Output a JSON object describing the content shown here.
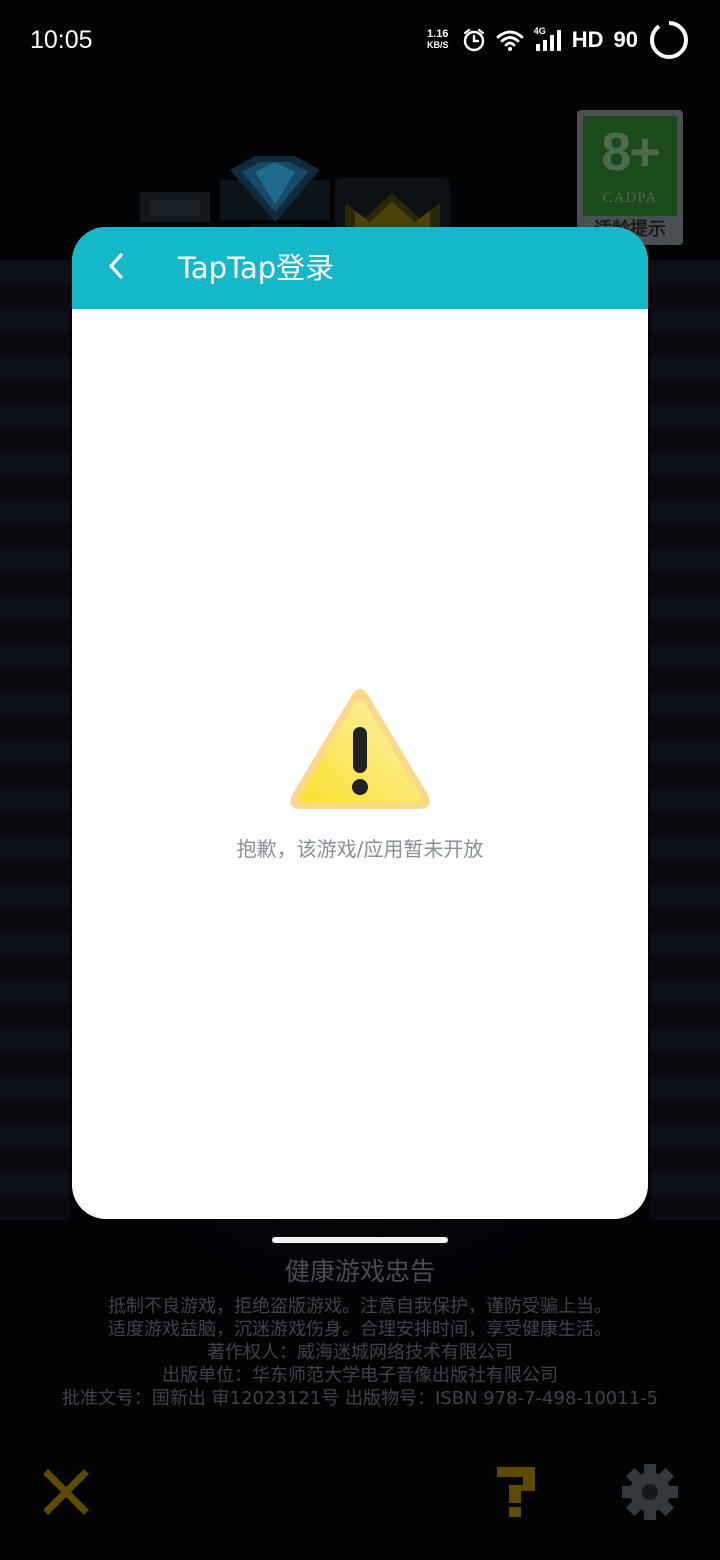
{
  "status_bar": {
    "time": "10:05",
    "net_speed_value": "1.16",
    "net_speed_unit": "KB/S",
    "network_type": "4G",
    "hd_label": "HD",
    "battery": "90",
    "icons": [
      "alarm-icon",
      "wifi-icon",
      "signal-icon",
      "battery-ring-icon"
    ]
  },
  "age_rating": {
    "rating": "8+",
    "org": "CADPA",
    "caption": "适龄提示"
  },
  "modal": {
    "title": "TapTap登录",
    "back_icon": "chevron-left-icon",
    "warning_icon": "warning-triangle-icon",
    "message": "抱歉，该游戏/应用暂未开放",
    "header_color": "#15b8c8"
  },
  "advisory": {
    "title": "健康游戏忠告",
    "lines": [
      "抵制不良游戏，拒绝盗版游戏。注意自我保护，谨防受骗上当。",
      "适度游戏益脑，沉迷游戏伤身。合理安排时间，享受健康生活。",
      "著作权人：威海迷城网络技术有限公司",
      "出版单位：华东师范大学电子音像出版社有限公司",
      "批准文号：国新出 审12023121号    出版物号：ISBN 978-7-498-10011-5"
    ]
  },
  "controls": {
    "close_icon": "close-icon",
    "help_icon": "question-icon",
    "settings_icon": "gear-icon",
    "accent_color": "#5c4a05"
  }
}
